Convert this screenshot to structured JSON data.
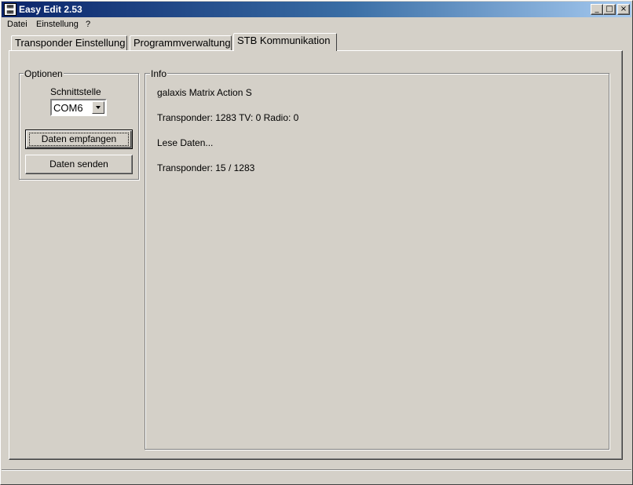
{
  "window": {
    "title": "Easy Edit 2.53",
    "controls": {
      "minimize": "_",
      "maximize": "□",
      "close": "×"
    }
  },
  "menu": [
    {
      "label": "Datei"
    },
    {
      "label": "Einstellung"
    },
    {
      "label": "?"
    }
  ],
  "tabs": [
    {
      "label": "Transponder Einstellung",
      "active": false
    },
    {
      "label": "Programmverwaltung",
      "active": false
    },
    {
      "label": "STB Kommunikation",
      "active": true
    }
  ],
  "options": {
    "group_label": "Optionen",
    "port_label": "Schnittstelle",
    "port_value": "COM6",
    "receive_button": "Daten empfangen",
    "send_button": "Daten senden"
  },
  "info": {
    "group_label": "Info",
    "lines": [
      "galaxis Matrix Action S",
      "Transponder: 1283 TV: 0 Radio: 0",
      "Lese Daten...",
      "Transponder: 15 / 1283"
    ]
  },
  "colors": {
    "face": "#d4d0c8",
    "titlebar_start": "#0a246a",
    "titlebar_end": "#a6caf0"
  }
}
